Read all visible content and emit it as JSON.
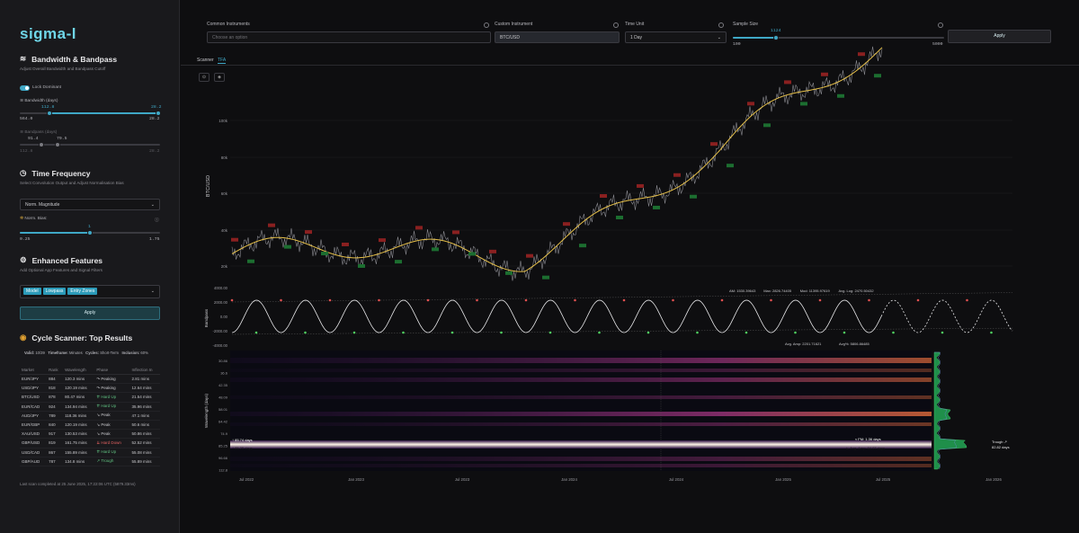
{
  "app": {
    "logo": "sigma-l"
  },
  "bandwidth": {
    "title": "Bandwidth & Bandpass",
    "subtitle": "Adjust Overall Bandwidth and Bandpass Cutoff",
    "lock_label": "Lock Dominant",
    "bw_label": "≋ Bandwidth (days)",
    "bw_value": "112.8",
    "bw_max_value": "28.2",
    "bw_min": "564.0",
    "bw_max": "28.2",
    "bp_label": "≋ Bandpass (days)",
    "bp_low": "91.4",
    "bp_high": "79.5",
    "bp_min": "112.8",
    "bp_max": "28.2"
  },
  "time_frequency": {
    "title": "Time Frequency",
    "subtitle": "Select Convolution Output and Adjust Normalisation Bias",
    "select_value": "Norm. Magnitude",
    "bias_label": "Norm. Bias:",
    "bias_value": "1",
    "bias_min": "0.25",
    "bias_max": "1.75"
  },
  "enhanced": {
    "title": "Enhanced Features",
    "subtitle": "Add Optional App Features and Signal Filters",
    "tags": [
      "Model",
      "Lowpass",
      "Entry Zones"
    ],
    "apply": "Apply"
  },
  "scanner": {
    "title": "Cycle Scanner: Top Results",
    "meta_valid_label": "Valid:",
    "meta_valid": "10/39",
    "meta_tf_label": "Timeframe:",
    "meta_tf": "Minutes",
    "meta_cycles_label": "Cycles:",
    "meta_cycles": "Short-Term",
    "meta_incl_label": "Inclusion:",
    "meta_incl": "60%",
    "headers": [
      "Market",
      "Rank",
      "Wavelength",
      "Phase",
      "Inflection In"
    ],
    "rows": [
      [
        "EUR/JPY",
        "884",
        "120.3 mins",
        "↷ Peaking",
        "2.81 mins"
      ],
      [
        "USD/JPY",
        "818",
        "120.19 mins",
        "↷ Peaking",
        "12.64 mins"
      ],
      [
        "BTC/USD",
        "878",
        "80.47 mins",
        "⇈ Hard Up",
        "21.54 mins"
      ],
      [
        "EUR/CAD",
        "924",
        "134.94 mins",
        "⇈ Hard Up",
        "35.96 mins"
      ],
      [
        "AUD/JPY",
        "789",
        "118.36 mins",
        "↘ Peak",
        "47.1 mins"
      ],
      [
        "EUR/GBP",
        "840",
        "120.19 mins",
        "↘ Peak",
        "50.6 mins"
      ],
      [
        "XAU/USD",
        "917",
        "130.53 mins",
        "↘ Peak",
        "50.86 mins"
      ],
      [
        "GBP/USD",
        "819",
        "161.75 mins",
        "⇊ Hard Down",
        "52.52 mins"
      ],
      [
        "USD/CAD",
        "867",
        "155.89 mins",
        "⇈ Hard Up",
        "55.08 mins"
      ],
      [
        "GBP/AUD",
        "787",
        "134.8 mins",
        "↗ Trough",
        "55.89 mins"
      ]
    ],
    "footer": "Last scan completed at 25 June 2025, 17:22:06 UTC (5879.33ms)"
  },
  "top": {
    "common_label": "Common Instruments",
    "common_placeholder": "Choose an option",
    "custom_label": "Custom Instrument",
    "custom_value": "BTC/USD",
    "unit_label": "Time Unit",
    "unit_value": "1 Day",
    "sample_label": "Sample Size",
    "sample_value": "1124",
    "sample_min": "100",
    "sample_max": "5000",
    "apply": "Apply"
  },
  "tabs": [
    "Scanner",
    "TFA"
  ],
  "chart": {
    "ylabel": "BTC/USD",
    "yticks": [
      "100k",
      "80k",
      "60k",
      "40k",
      "20k"
    ],
    "osc_ylabel": "Bandpass",
    "osc_ticks": [
      "4000.00",
      "2000.00",
      "0.00",
      "-2000.00",
      "-4000.00"
    ],
    "osc_stats": [
      "AM: 1530.39643",
      "Max: 2826.74405",
      "Mod: 11395.97619",
      "Avg. Log: 2470.50432"
    ],
    "spec_stats": [
      "Avg. Amp: 2201.71621",
      "Avg%: 5806.86485"
    ],
    "spec_ylabel": "Wavelength (days)",
    "spec_ticks": [
      "30.86",
      "36.6",
      "42.35",
      "48.09",
      "58.01",
      "64.42",
      "74.9",
      "85.25",
      "96.66",
      "112.8"
    ],
    "spec_labels": [
      "↑ 85.74 days",
      "↑ 85.25 days",
      "≈ FM: 1.36 days",
      "⊾ Avg. Amp: 84.07 days",
      "Trough ↗",
      "82.82 days"
    ],
    "xticks": [
      "Jul 2022",
      "Jan 2023",
      "Jul 2023",
      "Jan 2024",
      "Jul 2024",
      "Jan 2025",
      "Jul 2025",
      "Jan 2026"
    ]
  }
}
